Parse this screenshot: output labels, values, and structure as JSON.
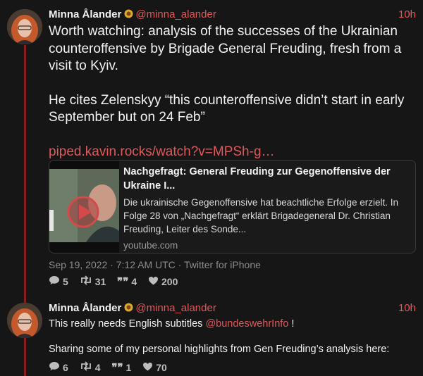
{
  "tweets": [
    {
      "author_name": "Minna Ålander",
      "handle": "@minna_alander",
      "time": "10h",
      "paragraphs": [
        "Worth watching: analysis of the successes of the Ukrainian counteroffensive by Brigade General Freuding, fresh from a visit to Kyiv.",
        "He cites Zelenskyy “this counteroffensive didn’t start in early September but on 24 Feb”"
      ],
      "link": "piped.kavin.rocks/watch?v=MPSh-g…",
      "card": {
        "title": "Nachgefragt: General Freuding zur Gegenoffensive der Ukraine I...",
        "description": "Die ukrainische Gegenoffensive hat beachtliche Erfolge erzielt. In Folge 28 von „Nachgefragt“ erklärt Brigadegeneral Dr. Christian Freuding, Leiter des Sonde...",
        "source": "youtube.com"
      },
      "meta": "Sep 19, 2022 · 7:12 AM UTC · Twitter for iPhone",
      "stats": {
        "replies": "5",
        "retweets": "31",
        "quotes": "4",
        "likes": "200"
      }
    },
    {
      "author_name": "Minna Ålander",
      "handle": "@minna_alander",
      "time": "10h",
      "line1_prefix": "This really needs English subtitles ",
      "mention": "@bundeswehrInfo",
      "line1_suffix": " !",
      "line2": "Sharing some of my personal highlights from Gen Freuding’s analysis here:",
      "stats": {
        "replies": "6",
        "retweets": "4",
        "quotes": "1",
        "likes": "70"
      }
    }
  ],
  "colors": {
    "accent": "#e0585a",
    "thread_line": "#8b1c1c",
    "background": "#161617"
  },
  "icons": [
    "sunflower-badge-icon",
    "play-icon",
    "reply-icon",
    "retweet-icon",
    "quote-icon",
    "heart-icon"
  ]
}
